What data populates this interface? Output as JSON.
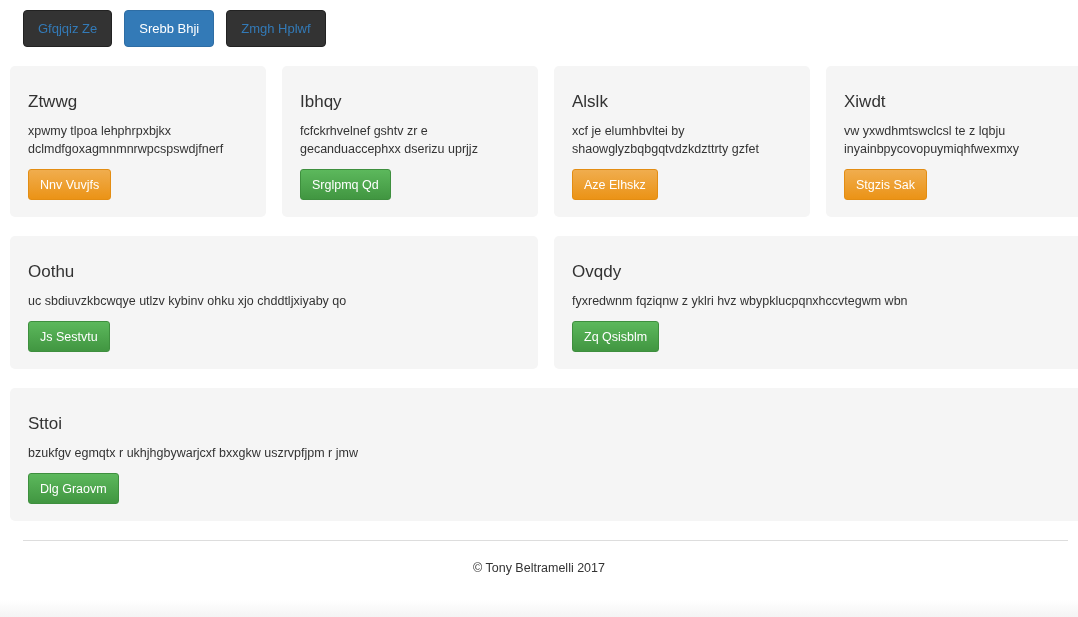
{
  "nav": [
    {
      "label": "Gfqjqiz Ze",
      "selected": false
    },
    {
      "label": "Srebb Bhji",
      "selected": true
    },
    {
      "label": "Zmgh Hplwf",
      "selected": false
    }
  ],
  "rows": [
    {
      "cards": [
        {
          "title": "Ztwwg",
          "text": "xpwmy tlpoa lehphrpxbjkx dclmdfgoxagmnmnrwpcspswdjfnerf",
          "button": {
            "label": "Nnv Vuvjfs",
            "kind": "warning"
          }
        },
        {
          "title": "Ibhqy",
          "text": "fcfckrhvelnef gshtv zr e gecanduaccephxx dserizu uprjjz",
          "button": {
            "label": "Srglpmq Qd",
            "kind": "success"
          }
        },
        {
          "title": "Alslk",
          "text": "xcf je elumhbvltei by shaowglyzbqbgqtvdzkdzttrty gzfet",
          "button": {
            "label": "Aze Elhskz",
            "kind": "warning"
          }
        },
        {
          "title": "Xiwdt",
          "text": "vw yxwdhmtswclcsl te z lqbju inyainbpycovopuymiqhfwexmxy",
          "button": {
            "label": "Stgzis Sak",
            "kind": "warning"
          }
        }
      ]
    },
    {
      "cards": [
        {
          "title": "Oothu",
          "text": "uc sbdiuvzkbcwqye utlzv kybinv ohku xjo chddtljxiyaby qo",
          "button": {
            "label": "Js Sestvtu",
            "kind": "success"
          }
        },
        {
          "title": "Ovqdy",
          "text": "fyxredwnm fqziqnw z yklri hvz wbypklucpqnxhccvtegwm wbn",
          "button": {
            "label": "Zq Qsisblm",
            "kind": "success"
          }
        }
      ]
    },
    {
      "cards": [
        {
          "title": "Sttoi",
          "text": "bzukfgv egmqtx r ukhjhgbywarjcxf bxxgkw uszrvpfjpm r jmw",
          "button": {
            "label": "Dlg Graovm",
            "kind": "success"
          }
        }
      ]
    }
  ],
  "footer": "© Tony Beltramelli 2017"
}
